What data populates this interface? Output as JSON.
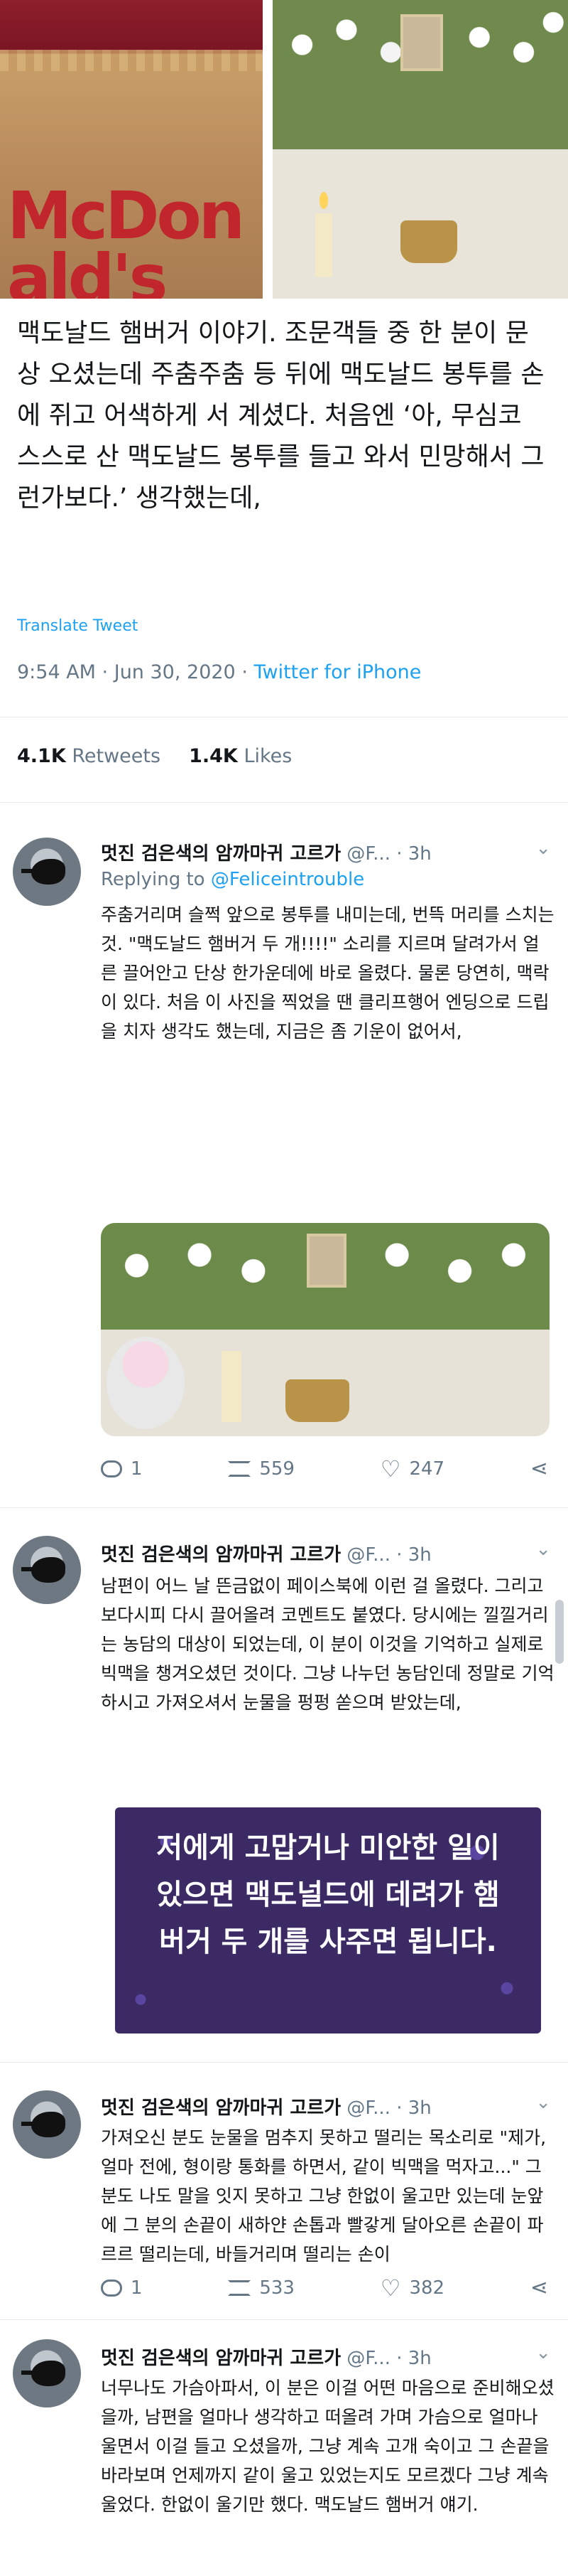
{
  "hero": {
    "bag_logo": "McDon\nald's"
  },
  "main_tweet": {
    "text": "맥도날드 햄버거 이야기. 조문객들 중 한 분이 문상 오셨는데 주춤주춤 등 뒤에 맥도날드 봉투를 손에 쥐고 어색하게 서 계셨다. 처음엔 ‘아, 무심코 스스로 산 맥도날드 봉투를 들고 와서 민망해서 그런가보다.’ 생각했는데,",
    "translate_label": "Translate Tweet",
    "time": "9:54 AM · Jun 30, 2020 · ",
    "via": "Twitter for iPhone",
    "retweets_count": "4.1K",
    "retweets_label": "Retweets",
    "likes_count": "1.4K",
    "likes_label": "Likes"
  },
  "replies": [
    {
      "name": "멋진 검은색의 암까마귀 고르가",
      "handle": "@F...",
      "age": "· 3h",
      "replying_prefix": "Replying to ",
      "replying_to": "@Feliceintrouble",
      "text": "주춤거리며 슬쩍 앞으로 봉투를 내미는데, 번뜩 머리를 스치는 것. \"맥도날드 햄버거 두 개!!!!\" 소리를 지르며 달려가서 얼른 끌어안고 단상 한가운데에 바로 올렸다. 물론 당연히, 맥락이 있다. 처음 이 사진을 찍었을 땐 클리프행어 엔딩으로 드립을 치자 생각도 했는데, 지금은 좀 기운이 없어서,",
      "reply_count": "1",
      "retweet_count": "559",
      "like_count": "247"
    },
    {
      "name": "멋진 검은색의 암까마귀 고르가",
      "handle": "@F...",
      "age": "· 3h",
      "text": "남편이 어느 날 뜬금없이 페이스북에 이런 걸 올렸다. 그리고 보다시피 다시 끌어올려 코멘트도 붙였다. 당시에는 낄낄거리는 농담의 대상이 되었는데, 이 분이 이것을 기억하고 실제로 빅맥을 챙겨오셨던 것이다. 그냥 나누던 농담인데 정말로 기억하시고 가져오셔서 눈물을 펑펑 쏟으며 받았는데,",
      "card_text": "저에게 고맙거나 미안한 일이 있으면 맥도널드에 데려가 햄버거 두 개를 사주면 됩니다."
    },
    {
      "name": "멋진 검은색의 암까마귀 고르가",
      "handle": "@F...",
      "age": "· 3h",
      "text": "가져오신 분도 눈물을 멈추지 못하고 떨리는 목소리로 \"제가, 얼마 전에, 형이랑 통화를 하면서, 같이 빅맥을 먹자고...\" 그 분도 나도 말을 잇지 못하고 그냥 한없이 울고만 있는데 눈앞에 그 분의 손끝이 새하얀 손톱과 빨갛게 달아오른 손끝이 파르르 떨리는데, 바들거리며 떨리는 손이",
      "reply_count": "1",
      "retweet_count": "533",
      "like_count": "382"
    },
    {
      "name": "멋진 검은색의 암까마귀 고르가",
      "handle": "@F...",
      "age": "· 3h",
      "text": "너무나도 가슴아파서, 이 분은 이걸 어떤 마음으로 준비해오셨을까, 남편을 얼마나 생각하고 떠올려 가며 가슴으로 얼마나 울면서 이걸 들고 오셨을까, 그냥 계속 고개 숙이고 그 손끝을 바라보며 언제까지 같이 울고 있었는지도 모르겠다 그냥 계속 울었다. 한없이 울기만 했다. 맥도날드 햄버거 얘기."
    }
  ]
}
